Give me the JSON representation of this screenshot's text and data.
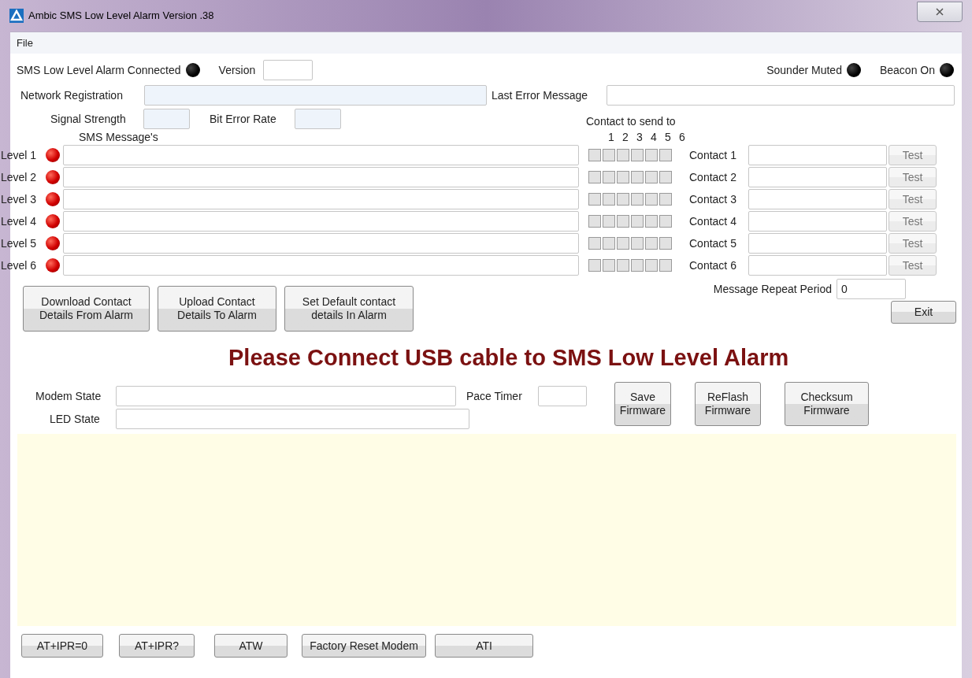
{
  "window": {
    "title": "Ambic SMS Low Level Alarm Version .38"
  },
  "menu": [
    {
      "label": "File"
    }
  ],
  "connected": {
    "label": "SMS Low Level Alarm Connected",
    "on": false
  },
  "version": {
    "label": "Version"
  },
  "sounder_muted": {
    "label": "Sounder Muted",
    "on": false
  },
  "beacon_on": {
    "label": "Beacon On",
    "on": false
  },
  "network_registration": {
    "label": "Network Registration"
  },
  "last_error_message": {
    "label": "Last Error Message"
  },
  "signal_strength": {
    "label": "Signal Strength"
  },
  "bit_error_rate": {
    "label": "Bit Error Rate"
  },
  "contact_to_send_to": "Contact to send to",
  "sms_messages_heading": "SMS Message's",
  "contact_numbers": [
    "1",
    "2",
    "3",
    "4",
    "5",
    "6"
  ],
  "levels": [
    {
      "label": "Level 1",
      "alarm": true,
      "send_to": [
        false,
        false,
        false,
        false,
        false,
        false
      ]
    },
    {
      "label": "Level 2",
      "alarm": true,
      "send_to": [
        false,
        false,
        false,
        false,
        false,
        false
      ]
    },
    {
      "label": "Level 3",
      "alarm": true,
      "send_to": [
        false,
        false,
        false,
        false,
        false,
        false
      ]
    },
    {
      "label": "Level 4",
      "alarm": true,
      "send_to": [
        false,
        false,
        false,
        false,
        false,
        false
      ]
    },
    {
      "label": "Level 5",
      "alarm": true,
      "send_to": [
        false,
        false,
        false,
        false,
        false,
        false
      ]
    },
    {
      "label": "Level 6",
      "alarm": true,
      "send_to": [
        false,
        false,
        false,
        false,
        false,
        false
      ]
    }
  ],
  "contacts": [
    {
      "label": "Contact 1",
      "button": "Test"
    },
    {
      "label": "Contact 2",
      "button": "Test"
    },
    {
      "label": "Contact 3",
      "button": "Test"
    },
    {
      "label": "Contact 4",
      "button": "Test"
    },
    {
      "label": "Contact 5",
      "button": "Test"
    },
    {
      "label": "Contact 6",
      "button": "Test"
    }
  ],
  "message_repeat_period": {
    "label": "Message Repeat Period",
    "value": "0"
  },
  "contact_buttons": [
    "Download Contact\nDetails From Alarm",
    "Upload Contact\nDetails To Alarm",
    "Set Default contact\ndetails In Alarm"
  ],
  "exit_button": "Exit",
  "banner": "Please Connect USB cable to SMS Low Level Alarm",
  "modem_state": {
    "label": "Modem State"
  },
  "pace_timer": {
    "label": "Pace Timer"
  },
  "led_state": {
    "label": "LED State"
  },
  "firmware_buttons": [
    "Save\nFirmware",
    "ReFlash\nFirmware",
    "Checksum\nFirmware"
  ],
  "at_buttons": [
    "AT+IPR=0",
    "AT+IPR?",
    "ATW",
    "Factory Reset Modem",
    "ATI"
  ]
}
